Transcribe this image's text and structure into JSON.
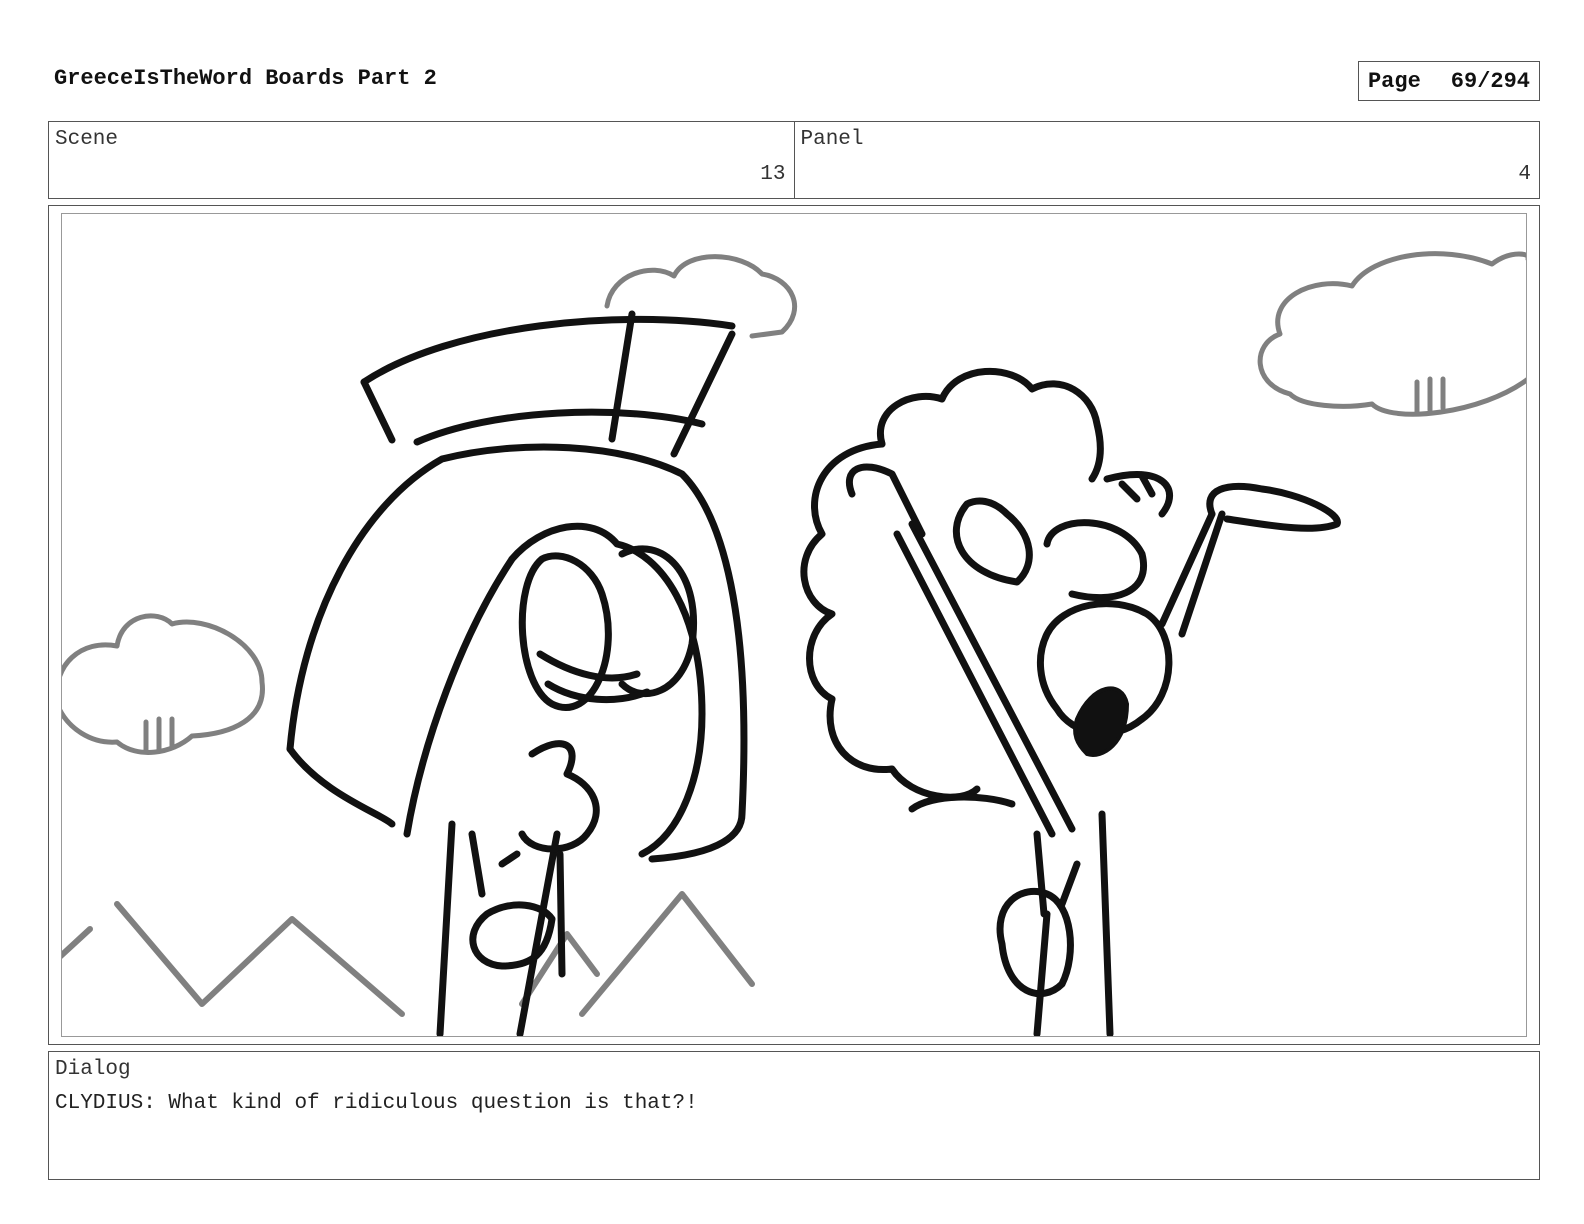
{
  "header": {
    "title": "GreeceIsTheWord Boards Part 2",
    "page_label": "Page",
    "page_number": "69/294"
  },
  "meta": {
    "scene_label": "Scene",
    "scene_value": "13",
    "panel_label": "Panel",
    "panel_value": "4"
  },
  "dialog": {
    "label": "Dialog",
    "text": "CLYDIUS: What kind of ridiculous question is that?!"
  },
  "colors": {
    "ink": "#111111",
    "background_sketch": "#808080",
    "border": "#555555"
  }
}
